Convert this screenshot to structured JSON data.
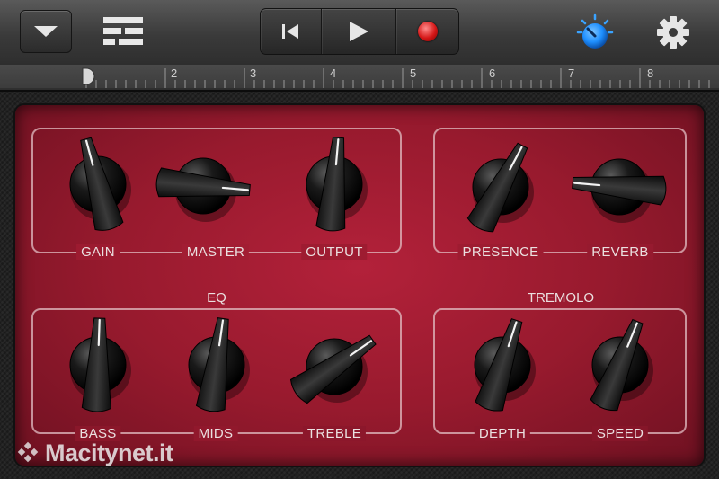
{
  "toolbar": {
    "menu_icon": "chevron-down-icon",
    "tracks_icon": "tracks-view-icon",
    "transport": {
      "rewind_icon": "go-to-beginning-icon",
      "play_icon": "play-icon",
      "record_icon": "record-icon"
    },
    "controls_icon": "smart-controls-knob-icon",
    "settings_icon": "gear-icon",
    "accent_blue": "#1e8fff",
    "record_red": "#d51717"
  },
  "ruler": {
    "bars": [
      "2",
      "3",
      "4",
      "5",
      "6",
      "7",
      "8"
    ]
  },
  "amp": {
    "panel_color": "#a51d33",
    "drive_group": {
      "knobs": [
        "GAIN",
        "MASTER",
        "OUTPUT"
      ]
    },
    "presence_group": {
      "knobs": [
        "PRESENCE",
        "REVERB"
      ]
    },
    "eq_group": {
      "title": "EQ",
      "knobs": [
        "BASS",
        "MIDS",
        "TREBLE"
      ]
    },
    "tremolo_group": {
      "title": "TREMOLO",
      "knobs": [
        "DEPTH",
        "SPEED"
      ]
    }
  },
  "watermark": {
    "text": "Macitynet.it"
  }
}
